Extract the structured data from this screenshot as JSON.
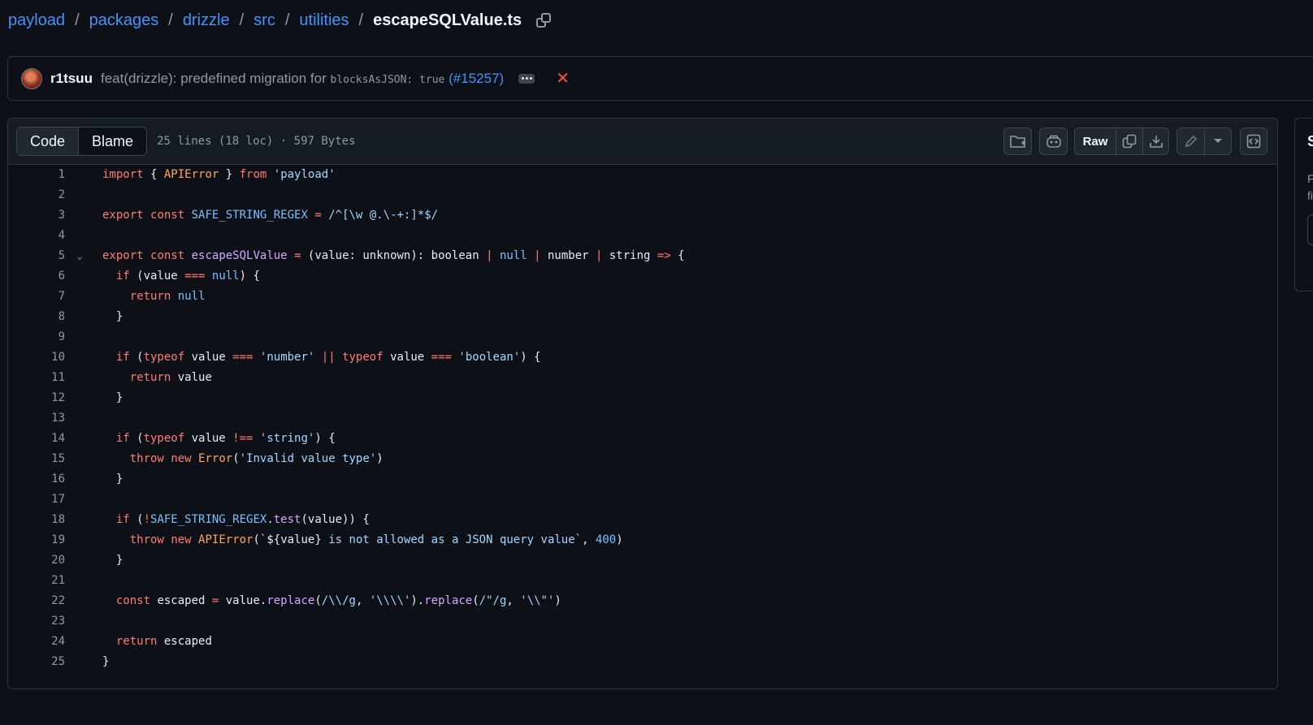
{
  "breadcrumb": {
    "items": [
      "payload",
      "packages",
      "drizzle",
      "src",
      "utilities"
    ],
    "separator": "/",
    "current_file": "escapeSQLValue.ts"
  },
  "commit": {
    "author": "r1tsuu",
    "message_prefix": "feat(drizzle): predefined migration for",
    "code": "blocksAsJSON: true",
    "pr_open": "(",
    "pr_number": "#15257",
    "pr_close": ")"
  },
  "file": {
    "tabs": [
      "Code",
      "Blame"
    ],
    "meta": "25 lines (18 loc) · 597 Bytes",
    "raw_label": "Raw"
  },
  "side_panel": {
    "title": "S",
    "text_lines": [
      "F",
      "fi"
    ]
  },
  "code_lines": [
    "import { APIError } from 'payload'",
    "",
    "export const SAFE_STRING_REGEX = /^[\\w @.\\-+:]*$/",
    "",
    "export const escapeSQLValue = (value: unknown): boolean | null | number | string => {",
    "  if (value === null) {",
    "    return null",
    "  }",
    "",
    "  if (typeof value === 'number' || typeof value === 'boolean') {",
    "    return value",
    "  }",
    "",
    "  if (typeof value !== 'string') {",
    "    throw new Error('Invalid value type')",
    "  }",
    "",
    "  if (!SAFE_STRING_REGEX.test(value)) {",
    "    throw new APIError(`${value} is not allowed as a JSON query value`, 400)",
    "  }",
    "",
    "  const escaped = value.replace(/\\\\/g, '\\\\\\\\').replace(/\"/g, '\\\\\"')",
    "",
    "  return escaped",
    "}"
  ]
}
